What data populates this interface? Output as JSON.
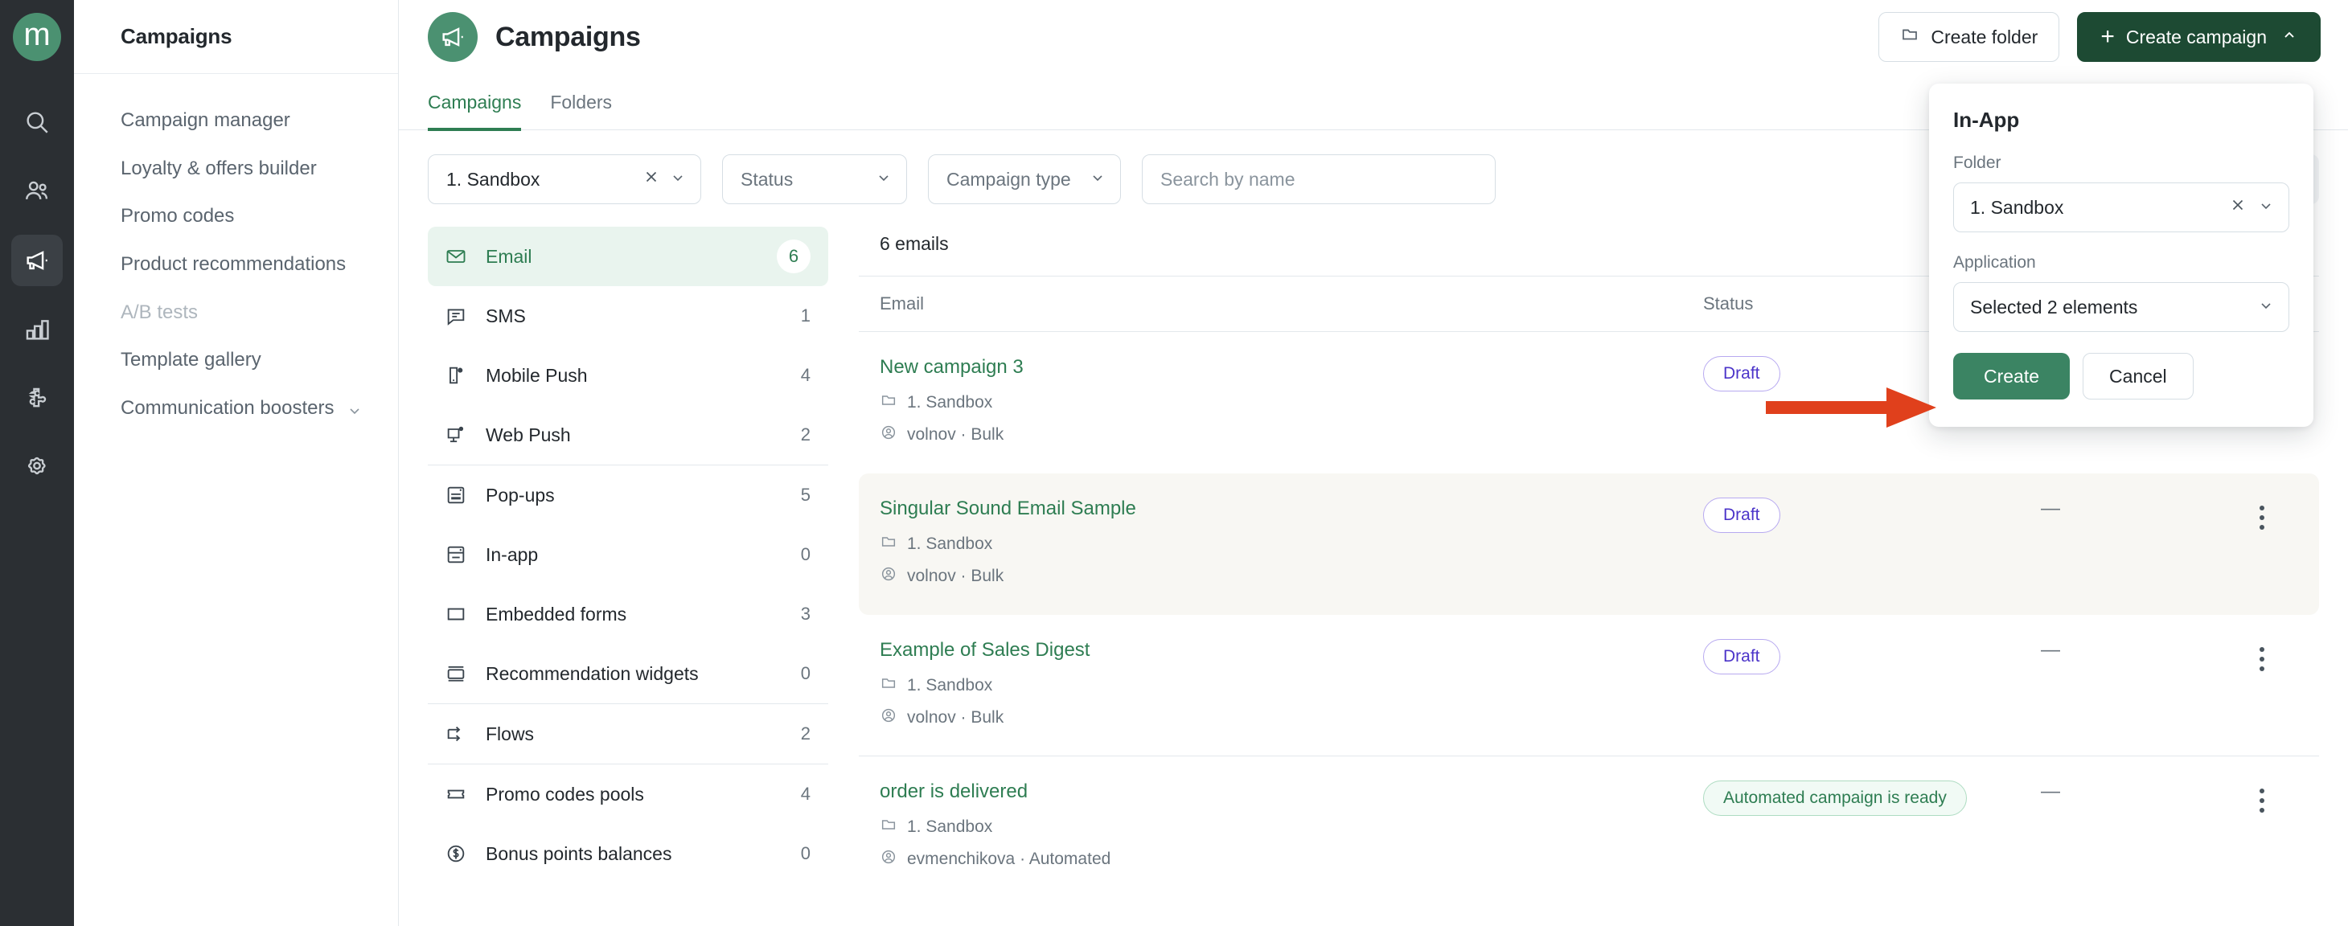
{
  "brand": {
    "logo_letter": "m",
    "logo_color": "#4B9171",
    "primary_green": "#1D4A33",
    "accent_green": "#2E7D52",
    "annotation_red": "#E0401C"
  },
  "rail": {
    "items": [
      {
        "name": "search-icon",
        "label": "Search",
        "active": false
      },
      {
        "name": "users-icon",
        "label": "Customers",
        "active": false
      },
      {
        "name": "megaphone-icon",
        "label": "Campaigns",
        "active": true
      },
      {
        "name": "bar-chart-icon",
        "label": "Analytics",
        "active": false
      },
      {
        "name": "puzzle-icon",
        "label": "Integrations",
        "active": false
      },
      {
        "name": "gear-icon",
        "label": "Settings",
        "active": false
      }
    ]
  },
  "sidebar": {
    "title": "Campaigns",
    "items": [
      {
        "label": "Campaign manager",
        "dim": false,
        "chevron": false
      },
      {
        "label": "Loyalty & offers builder",
        "dim": false,
        "chevron": false
      },
      {
        "label": "Promo codes",
        "dim": false,
        "chevron": false
      },
      {
        "label": "Product recommendations",
        "dim": false,
        "chevron": false
      },
      {
        "label": "A/B tests",
        "dim": true,
        "chevron": false
      },
      {
        "label": "Template gallery",
        "dim": false,
        "chevron": false
      },
      {
        "label": "Communication boosters",
        "dim": false,
        "chevron": true
      }
    ]
  },
  "header": {
    "title": "Campaigns",
    "avatar_icon": "megaphone-icon",
    "create_folder_label": "Create folder",
    "create_campaign_label": "Create campaign",
    "create_campaign_plus": "+"
  },
  "tabs": [
    {
      "label": "Campaigns",
      "active": true
    },
    {
      "label": "Folders",
      "active": false
    }
  ],
  "filters": {
    "folder_value": "1. Sandbox",
    "status_placeholder": "Status",
    "campaign_type_placeholder": "Campaign type",
    "search_placeholder": "Search by name",
    "view_toggle_icon": "list-view-icon"
  },
  "channels": {
    "groups": [
      {
        "items": [
          {
            "label": "Email",
            "count": "6",
            "icon": "envelope-icon",
            "active": true
          },
          {
            "label": "SMS",
            "count": "1",
            "icon": "chat-bubble-icon",
            "active": false
          },
          {
            "label": "Mobile Push",
            "count": "4",
            "icon": "mobile-push-icon",
            "active": false
          },
          {
            "label": "Web Push",
            "count": "2",
            "icon": "web-push-icon",
            "active": false
          }
        ]
      },
      {
        "items": [
          {
            "label": "Pop-ups",
            "count": "5",
            "icon": "popup-icon",
            "active": false
          },
          {
            "label": "In-app",
            "count": "0",
            "icon": "in-app-icon",
            "active": false
          },
          {
            "label": "Embedded forms",
            "count": "3",
            "icon": "embedded-form-icon",
            "active": false
          },
          {
            "label": "Recommendation widgets",
            "count": "0",
            "icon": "widget-icon",
            "active": false
          }
        ]
      },
      {
        "items": [
          {
            "label": "Flows",
            "count": "2",
            "icon": "flow-icon",
            "active": false
          }
        ]
      },
      {
        "items": [
          {
            "label": "Promo codes pools",
            "count": "4",
            "icon": "ticket-icon",
            "active": false
          },
          {
            "label": "Bonus points balances",
            "count": "0",
            "icon": "dollar-circle-icon",
            "active": false
          }
        ]
      }
    ]
  },
  "table": {
    "count_label": "6 emails",
    "columns": {
      "email": "Email",
      "status": "Status"
    },
    "rows": [
      {
        "name": "New campaign 3",
        "folder": "1. Sandbox",
        "author": "volnov · Bulk",
        "status": "Draft",
        "status_kind": "draft",
        "extra": "",
        "hover": false,
        "divider_after": false
      },
      {
        "name": "Singular Sound Email Sample",
        "folder": "1. Sandbox",
        "author": "volnov · Bulk",
        "status": "Draft",
        "status_kind": "draft",
        "extra": "—",
        "hover": true,
        "divider_after": false
      },
      {
        "name": "Example of Sales Digest",
        "folder": "1. Sandbox",
        "author": "volnov · Bulk",
        "status": "Draft",
        "status_kind": "draft",
        "extra": "—",
        "hover": false,
        "divider_after": true
      },
      {
        "name": "order is delivered",
        "folder": "1. Sandbox",
        "author": "evmenchikova · Automated",
        "status": "Automated campaign is ready",
        "status_kind": "ready",
        "extra": "—",
        "hover": false,
        "divider_after": false
      }
    ]
  },
  "popover": {
    "title": "In-App",
    "folder_label": "Folder",
    "folder_value": "1. Sandbox",
    "application_label": "Application",
    "application_value": "Selected 2 elements",
    "create_label": "Create",
    "cancel_label": "Cancel"
  },
  "annotation": {
    "type": "arrow-right",
    "color": "#E0401C",
    "points_to": "Create"
  }
}
